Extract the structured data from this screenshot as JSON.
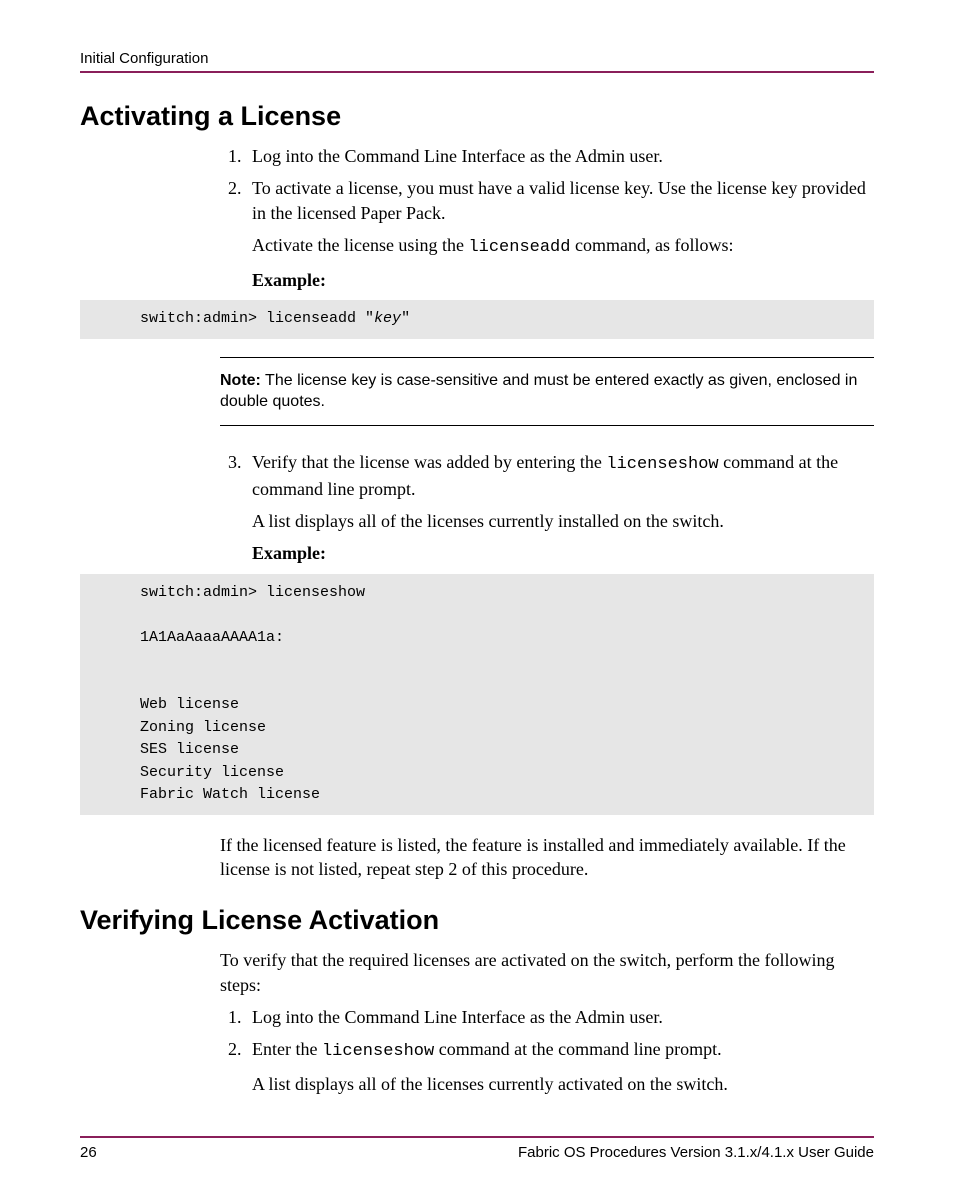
{
  "header": {
    "section": "Initial Configuration"
  },
  "section1": {
    "title": "Activating a License",
    "step1": "Log into the Command Line Interface as the Admin user.",
    "step2": "To activate a license, you must have a valid license key. Use the license key provided in the licensed Paper Pack.",
    "step2_para_a": "Activate the license using the ",
    "step2_cmd": "licenseadd",
    "step2_para_b": " command, as follows:",
    "example_label": "Example:",
    "code1_prefix": "switch:admin> licenseadd \"",
    "code1_key": "key",
    "code1_suffix": "\"",
    "note_label": "Note:",
    "note_text": "  The license key is case-sensitive and must be entered exactly as given, enclosed in double quotes.",
    "step3_a": "Verify that the license was added by entering the ",
    "step3_cmd": "licenseshow",
    "step3_b": " command at the command line prompt.",
    "step3_para": "A list displays all of the licenses currently installed on the switch.",
    "code2": "switch:admin> licenseshow\n\n1A1AaAaaaAAAA1a:\n\n\nWeb license\nZoning license\nSES license\nSecurity license\nFabric Watch license",
    "after_para": "If the licensed feature is listed, the feature is installed and immediately available. If the license is not listed, repeat step 2 of this procedure."
  },
  "section2": {
    "title": "Verifying License Activation",
    "intro": "To verify that the required licenses are activated on the switch, perform the following steps:",
    "step1": "Log into the Command Line Interface as the Admin user.",
    "step2_a": "Enter the ",
    "step2_cmd": "licenseshow",
    "step2_b": " command at the command line prompt.",
    "step2_para": "A list displays all of the licenses currently activated on the switch."
  },
  "footer": {
    "page": "26",
    "doc": "Fabric OS Procedures Version 3.1.x/4.1.x User Guide"
  }
}
